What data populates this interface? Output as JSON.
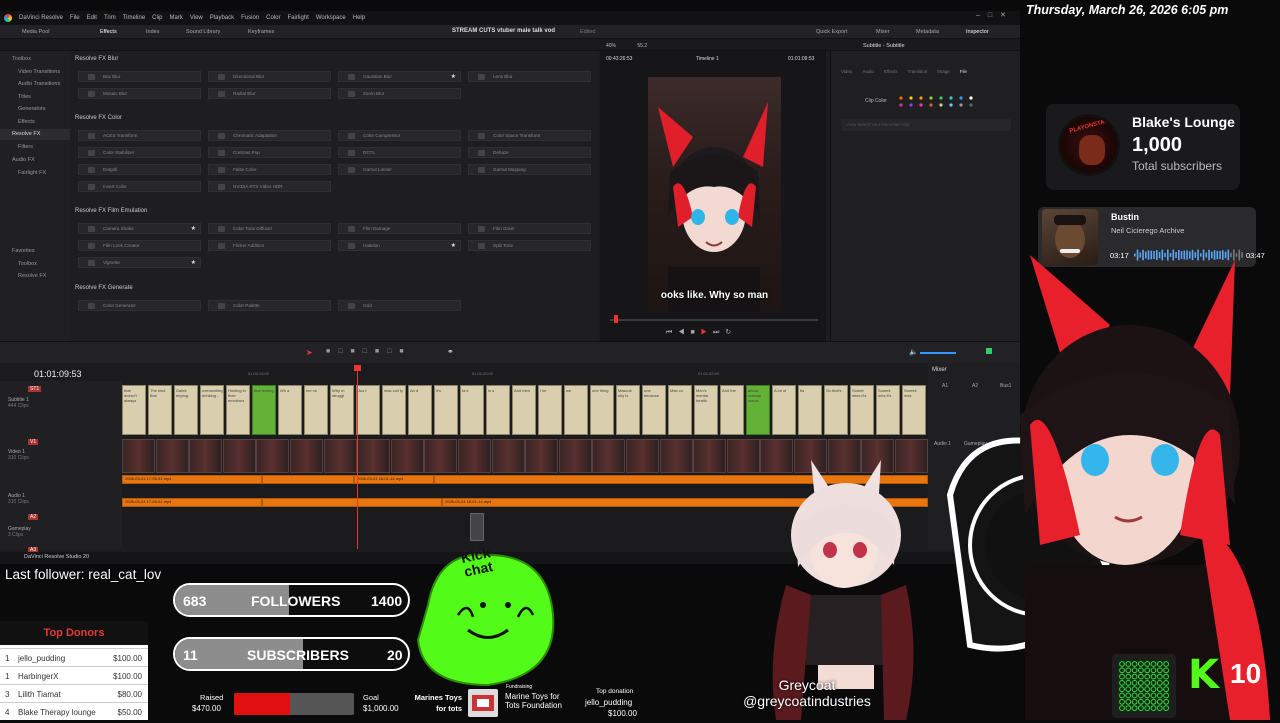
{
  "resolve": {
    "menu": [
      "DaVinci Resolve",
      "File",
      "Edit",
      "Trim",
      "Timeline",
      "Clip",
      "Mark",
      "View",
      "Playback",
      "Fusion",
      "Color",
      "Fairlight",
      "Workspace",
      "Help"
    ],
    "toolbar": {
      "media_pool": "Media Pool",
      "effects": "Effects",
      "index": "Index",
      "sound_library": "Sound Library",
      "keyframes": "Keyframes",
      "project_title": "STREAM CUTS vtuber male talk vod",
      "edited": "Edited",
      "quick_export": "Quick Export",
      "mixer": "Mixer",
      "metadata": "Metadata",
      "inspector": "Inspector"
    },
    "sidebar": [
      "Toolbox",
      "Video Transitions",
      "Audio Transitions",
      "Titles",
      "Generators",
      "Effects",
      "Resolve FX",
      "Filters",
      "Audio FX",
      "Fairlight FX",
      "Favorites",
      "Toolbox",
      "Resolve FX"
    ],
    "fx_sections": [
      {
        "title": "Resolve FX Blur",
        "items": [
          "Box Blur",
          "Directional Blur",
          "Gaussian Blur",
          "Lens Blur",
          "Mosaic Blur",
          "Radial Blur",
          "Zoom Blur"
        ]
      },
      {
        "title": "Resolve FX Color",
        "items": [
          "ACES Transform",
          "Chromatic Adaptation",
          "Color Compressor",
          "Color Space Transform",
          "Color Stabilizer",
          "Contrast Pop",
          "DCTL",
          "Dehaze",
          "Dotgrill",
          "False Color",
          "Gamut Limiter",
          "Gamut Mapping",
          "Invert Color",
          "NVIDIA RTX Video HDR"
        ]
      },
      {
        "title": "Resolve FX Film Emulation",
        "items": [
          "Camera Shake",
          "Color Tone Diffuser",
          "Film Damage",
          "Film Grain",
          "Film Look Creator",
          "Flicker Addition",
          "Halation",
          "Split Tone",
          "Vignette"
        ]
      },
      {
        "title": "Resolve FX Generate",
        "items": [
          "Color Generator",
          "Color Palette",
          "Grid"
        ]
      }
    ],
    "viewer": {
      "zoom": "40%",
      "fps": "55.2",
      "timecode_left": "00:43:26:53",
      "timeline_name": "Timeline 1",
      "timecode_right": "01:01:09:53",
      "subtitle": "ooks like. Why so man"
    },
    "inspector": {
      "title": "Subtitle - Subtitle",
      "tabs": [
        "Video",
        "Audio",
        "Effects",
        "Transition",
        "Image",
        "File"
      ],
      "clip_color_label": "Clip Color",
      "hint": "Auto Select Your Uncertain Clip"
    },
    "timeline": {
      "timecode": "01:01:09:53",
      "ruler": [
        "01:00:16:00",
        "01:01:20:00",
        "01:01:52:00"
      ],
      "tracks": [
        {
          "id": "ST1",
          "name": "Subtitle 1",
          "info": "444 Clips"
        },
        {
          "id": "V1",
          "name": "Video 1",
          "info": "310 Clips"
        },
        {
          "id": "A1",
          "name": "Audio 1",
          "info": "310 Clips"
        },
        {
          "id": "A2",
          "name": "Gameplay",
          "info": "3 Clips"
        },
        {
          "id": "A3",
          "name": "",
          "info": ""
        }
      ],
      "subtitle_clips": [
        "that doesn't always",
        "The kind that",
        "Gatek eeping,",
        "overworking, drinking...",
        "Holding in their emotions",
        "that feeling",
        "Wh a",
        "me ns",
        "Why m struggl",
        "Jus t",
        "mas culi ty",
        "An d",
        "It's",
        "fa it",
        "in s",
        "And men",
        "I ke",
        "we",
        "one thing",
        "Masculi nity is",
        "one because",
        "Mas cu",
        "Men's mental health",
        "And the",
        "about nobody warns",
        "A lot of",
        "Its",
        "So that's",
        "Somet imes it's",
        "Someti mes it's",
        "Someti mes"
      ],
      "audio_label": "2026-03-24 17-55-51.mp4",
      "audio_label_b": "2026-03-24 18-01-14.mp4"
    },
    "mixer": {
      "title": "Mixer",
      "channels": [
        "A1",
        "A2",
        "Bus1"
      ],
      "audio_label": "Audio 1",
      "gameplay_label": "Gameplay"
    },
    "status": "DaVinci Resolve Studio 20"
  },
  "overlay": {
    "datetime": "Thursday, March 26, 2026 6:05 pm",
    "channel": {
      "name": "Blake's Lounge",
      "subscribers": "1,000",
      "subscribers_label": "Total subscribers",
      "avatar_text": "PLAYONSTAGE"
    },
    "music": {
      "title": "Bustin",
      "artist": "Neil Cicierego Archive",
      "elapsed": "03:17",
      "total": "03:47",
      "progress": 0.87
    },
    "last_follower": "Last follower: real_cat_lov",
    "followers_goal": {
      "current": "683",
      "label": "FOLLOWERS",
      "target": "1400",
      "fraction": 0.488
    },
    "subscribers_goal": {
      "current": "11",
      "label": "SUBSCRIBERS",
      "target": "20",
      "fraction": 0.55
    },
    "kick_sticker": "Kick chat",
    "donors": {
      "title": "Top Donors",
      "rows": [
        {
          "rank": "1",
          "name": "jello_pudding",
          "amount": "$100.00"
        },
        {
          "rank": "1",
          "name": "HarbingerX",
          "amount": "$100.00"
        },
        {
          "rank": "3",
          "name": "Lilith Tiamat",
          "amount": "$80.00"
        },
        {
          "rank": "4",
          "name": "Blake Therapy lounge",
          "amount": "$50.00"
        }
      ]
    },
    "charity": {
      "raised_label": "Raised",
      "raised": "$470.00",
      "raised_fraction": 0.47,
      "goal_label": "Goal",
      "goal": "$1,000.00",
      "campaign": "Marines Toys for tots",
      "org_label": "Marine Toys for Tots Foundation",
      "org_top": "Fundraising",
      "top_label": "Top donation",
      "top_name": "jello_pudding",
      "top_amount": "$100.00"
    },
    "guest": {
      "name": "Greycoat",
      "handle": "@greycoatindustries"
    },
    "badge": {
      "kick_letter": "K",
      "count": "10"
    },
    "colors": {
      "accent_red": "#e23b3b",
      "kick_green": "#53fc18",
      "timeline_orange": "#e9750f",
      "subtitle_clip": "#d9cfae",
      "ring_green": "#3fd24a"
    }
  }
}
